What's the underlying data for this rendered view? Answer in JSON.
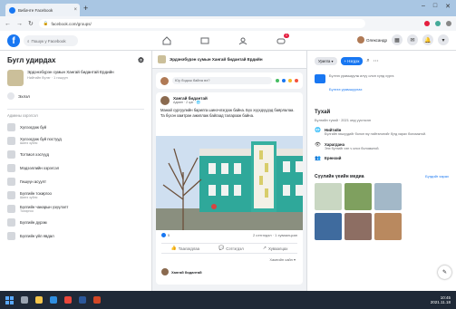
{
  "browser": {
    "tab_title": "Вибачте Facebook",
    "url": "facebook.com/groups/",
    "newtab_label": "+",
    "minimize": "–",
    "maximize": "□",
    "close": "✕"
  },
  "fb": {
    "search_placeholder": "Пошук у Facebook",
    "nav_badge": "1",
    "profile_name": "Олександр"
  },
  "left": {
    "title": "Бугл удирдах",
    "group_name": "Эрдэнэбүрэн сумын Хангай бидантай Ердийн",
    "group_meta": "Нийтийн бүлэг · 1 гишүүн",
    "home_label": "Эхлэл",
    "section_label": "Админы хэрэгсэл",
    "items": [
      {
        "label": "Хүлээгдэж буй",
        "sub": ""
      },
      {
        "label": "Хүлээгдэж буй постууд",
        "sub": "Шинэ зүйлс"
      },
      {
        "label": "Тогтмол хэсгүүд",
        "sub": ""
      },
      {
        "label": "Мэдээллийн хэрэгсэл",
        "sub": ""
      },
      {
        "label": "Гишүүн асуулт",
        "sub": ""
      },
      {
        "label": "Бүлгийн тохиргоо",
        "sub": "Шинэ зүйлс"
      },
      {
        "label": "Бүлгийн чанарын үзүүлэлт",
        "sub": "Тохиргоо"
      },
      {
        "label": "Бүлгийн дүрэм",
        "sub": ""
      },
      {
        "label": "Бүлгийн үйл явдал",
        "sub": ""
      }
    ]
  },
  "center": {
    "group_title": "Эрдэнэбүрэн сумын Хангай бидантай Ердийн",
    "composer_placeholder": "Юу бодож байна вэ?",
    "post_author": "Хангай бидантай",
    "post_meta": "Админ · 2 цаг · 🌐",
    "post_text": "Манай сургуулийн барилга шинэчлэгдэж байна. Бүх хүүхдүүдэд баярлалаа. Та бүхэн хамтран ажиллаж байгаад талархаж байна.",
    "reactions_count": "5",
    "comments_info": "2 сэтгэгдэл · 1 хуваалцсан",
    "like_label": "Таалагдлаа",
    "comment_label": "Сэтгэгдэл",
    "share_label": "Хуваалцах",
    "sort_label": "Хамгийн сайн ▾",
    "commenter": "Хангай бидантай"
  },
  "right": {
    "invite_label": "Урилга ▾",
    "join_label": "+ Нэгдэх",
    "promo_text": "Бүлгээ урамшуулж илүү олон хүнд хүргэ.",
    "promo_link": "Бүлгээ урамшуулах",
    "about_title": "Тухай",
    "about_sub": "Бүлгийн тухай · 2021 онд үүсгэсэн",
    "public_title": "Нийтийн",
    "public_desc": "Бүлгийн гишүүдийг болон юу нийтэлснийг бүгд харах боломжтой.",
    "visible_title": "Харагдана",
    "visible_desc": "Энэ бүлгийг хэн ч олох боломжтой.",
    "general_title": "Ерөнхий",
    "media_title": "Сүүлийн үеийн медиа",
    "see_all": "Бүгдийг харах"
  },
  "taskbar": {
    "time": "10:45",
    "date": "2021.11.18"
  },
  "colors": {
    "brand": "#1877f2",
    "badge": "#e41e3f",
    "building": "#2fa89a"
  }
}
